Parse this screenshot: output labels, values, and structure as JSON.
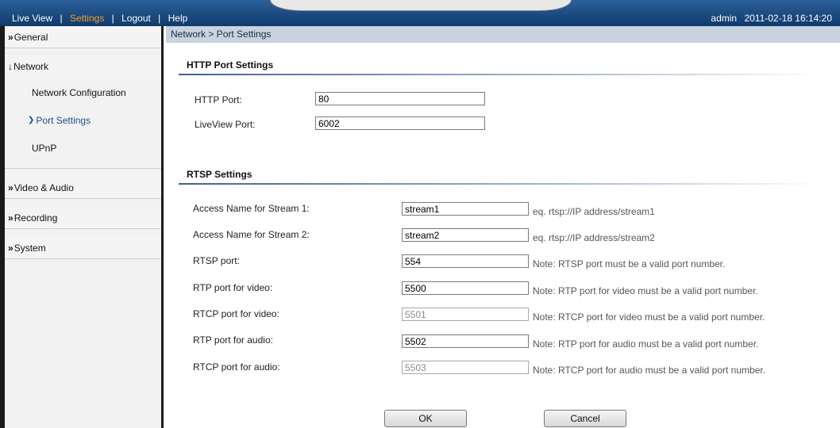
{
  "topbar": {
    "nav": [
      {
        "label": "Live View",
        "active": false
      },
      {
        "label": "Settings",
        "active": true
      },
      {
        "label": "Logout",
        "active": false
      },
      {
        "label": "Help",
        "active": false
      }
    ],
    "separator": "|",
    "user": "admin",
    "datetime": "2011-02-18 16:14:20"
  },
  "sidebar": {
    "chevron": "»",
    "general": "General",
    "network": "Network",
    "network_items": [
      "Network Configuration",
      "Port Settings",
      "UPnP"
    ],
    "video_audio": "Video & Audio",
    "recording": "Recording",
    "system": "System"
  },
  "main": {
    "breadcrumb": "Network > Port Settings",
    "http_section": "HTTP Port Settings",
    "http_port_label": "HTTP Port:",
    "http_port_value": "80",
    "liveview_port_label": "LiveView Port:",
    "liveview_port_value": "6002",
    "rtsp_section": "RTSP Settings",
    "rtsp_rows": [
      {
        "label": "Access Name for Stream 1:",
        "value": "stream1",
        "hint": "eq. rtsp://IP address/stream1",
        "disabled": false
      },
      {
        "label": "Access Name for Stream 2:",
        "value": "stream2",
        "hint": "eq. rtsp://IP address/stream2",
        "disabled": false
      },
      {
        "label": "RTSP port:",
        "value": "554",
        "hint": "Note: RTSP port must be a valid port number.",
        "disabled": false
      },
      {
        "label": "RTP port for video:",
        "value": "5500",
        "hint": "Note: RTP port for video must be a valid port number.",
        "disabled": false
      },
      {
        "label": "RTCP port for video:",
        "value": "5501",
        "hint": "Note: RTCP port for video must be a valid port number.",
        "disabled": true
      },
      {
        "label": "RTP port for audio:",
        "value": "5502",
        "hint": "Note: RTP port for audio must be a valid port number.",
        "disabled": false
      },
      {
        "label": "RTCP port for audio:",
        "value": "5503",
        "hint": "Note: RTCP port for audio must be a valid port number.",
        "disabled": true
      }
    ],
    "ok_label": "OK",
    "cancel_label": "Cancel"
  },
  "colors": {
    "topbar": "#1b4a7f",
    "active_nav": "#f39c35",
    "breadcrumb_bg": "#c9d3df",
    "section_line": "#41618f"
  }
}
